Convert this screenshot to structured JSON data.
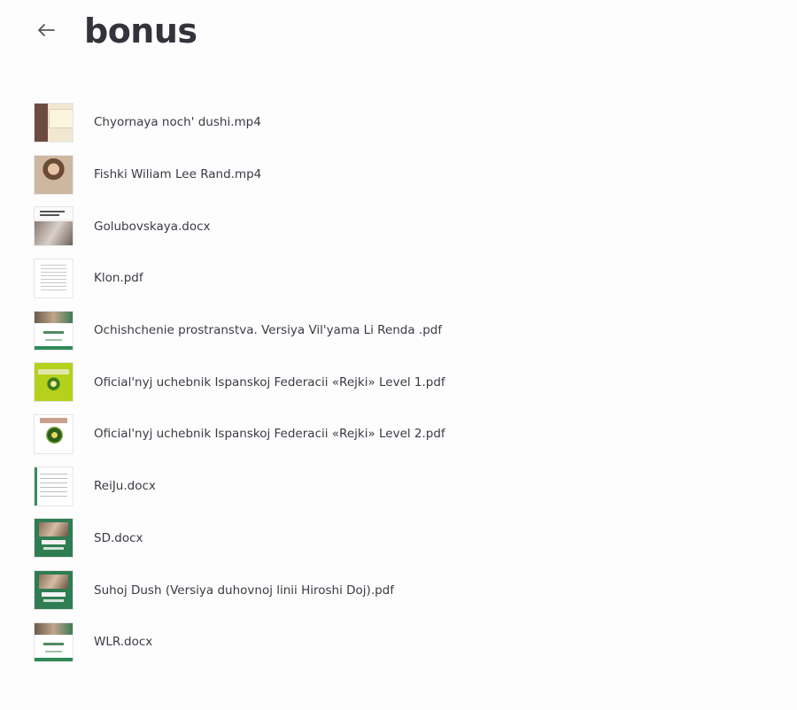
{
  "header": {
    "back_icon": "arrow-left-icon",
    "title": "bonus"
  },
  "files": [
    {
      "name": "Chyornaya noch' dushi.mp4",
      "thumb": "video-thumbnail"
    },
    {
      "name": "Fishki Wiliam Lee Rand.mp4",
      "thumb": "video-thumbnail"
    },
    {
      "name": "Golubovskaya.docx",
      "thumb": "document-thumbnail"
    },
    {
      "name": "Klon.pdf",
      "thumb": "pdf-thumbnail"
    },
    {
      "name": "Ochishchenie prostranstva. Versiya Vil'yama Li Renda .pdf",
      "thumb": "pdf-thumbnail"
    },
    {
      "name": "Oficial'nyj uchebnik Ispanskoj Federacii «Rejki» Level 1.pdf",
      "thumb": "pdf-thumbnail"
    },
    {
      "name": "Oficial'nyj uchebnik Ispanskoj Federacii «Rejki» Level 2.pdf",
      "thumb": "pdf-thumbnail"
    },
    {
      "name": "ReiJu.docx",
      "thumb": "document-thumbnail"
    },
    {
      "name": "SD.docx",
      "thumb": "document-thumbnail"
    },
    {
      "name": "Suhoj Dush (Versiya duhovnoj linii Hiroshi Doj).pdf",
      "thumb": "pdf-thumbnail"
    },
    {
      "name": "WLR.docx",
      "thumb": "document-thumbnail"
    }
  ]
}
